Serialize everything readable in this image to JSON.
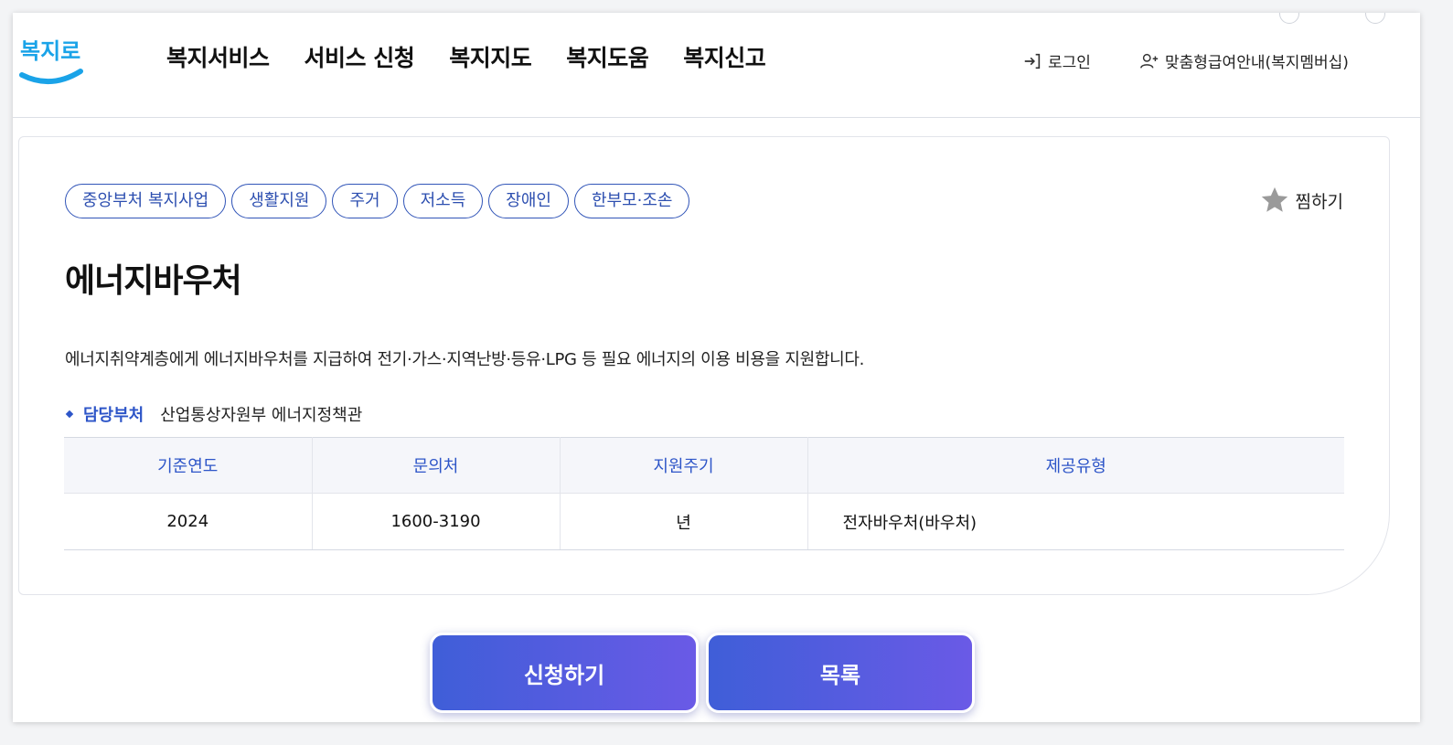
{
  "header": {
    "logo_text": "복지로",
    "nav": [
      "복지서비스",
      "서비스 신청",
      "복지지도",
      "복지도움",
      "복지신고"
    ],
    "login_label": "로그인",
    "member_label": "맞춤형급여안내(복지멤버십)"
  },
  "service": {
    "tags": [
      "중앙부처 복지사업",
      "생활지원",
      "주거",
      "저소득",
      "장애인",
      "한부모·조손"
    ],
    "bookmark_label": "찜하기",
    "title": "에너지바우처",
    "description": "에너지취약계층에게 에너지바우처를 지급하여 전기·가스·지역난방·등유·LPG 등 필요 에너지의 이용 비용을 지원합니다.",
    "dept_label": "담당부처",
    "dept_value": "산업통상자원부 에너지정책관",
    "table": {
      "headers": [
        "기준연도",
        "문의처",
        "지원주기",
        "제공유형"
      ],
      "row": [
        "2024",
        "1600-3190",
        "년",
        "전자바우처(바우처)"
      ]
    }
  },
  "actions": {
    "apply_label": "신청하기",
    "list_label": "목록"
  },
  "colors": {
    "accent_blue": "#2d55c8",
    "logo_blue": "#1aa3e8",
    "button_gradient_start": "#3f5ed8",
    "button_gradient_end": "#6a5ae6"
  }
}
